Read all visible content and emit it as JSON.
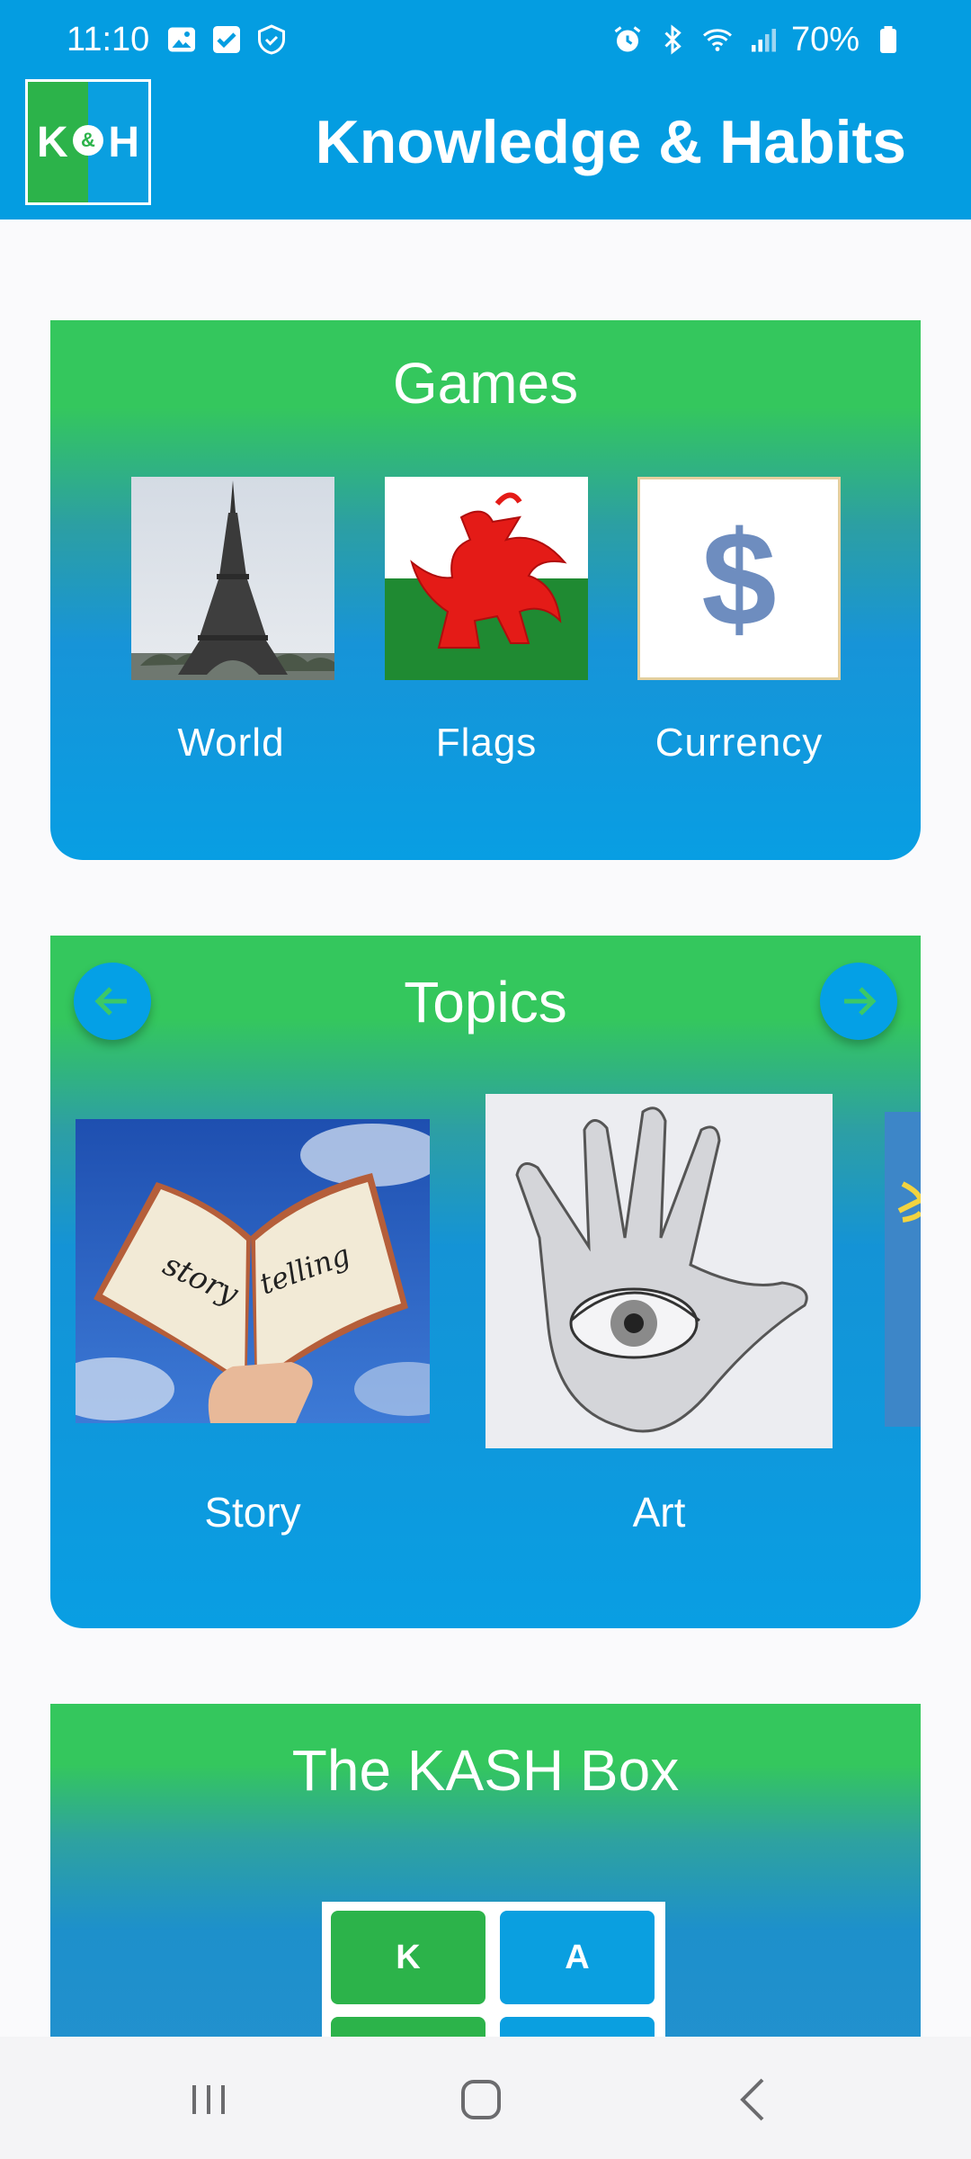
{
  "status_bar": {
    "time": "11:10",
    "battery": "70%",
    "left_icons": [
      "image-icon",
      "check-box-icon",
      "shield-icon"
    ],
    "right_icons": [
      "alarm-icon",
      "bluetooth-icon",
      "wifi-icon",
      "signal-icon",
      "battery-icon"
    ]
  },
  "header": {
    "logo_k": "K",
    "logo_amp": "&",
    "logo_h": "H",
    "title": "Knowledge & Habits"
  },
  "games": {
    "title": "Games",
    "items": [
      {
        "label": "World",
        "icon": "eiffel-tower-image"
      },
      {
        "label": "Flags",
        "icon": "welsh-flag-image"
      },
      {
        "label": "Currency",
        "icon": "dollar-sign-image",
        "symbol": "$"
      }
    ]
  },
  "topics": {
    "title": "Topics",
    "prev_icon": "arrow-left-icon",
    "next_icon": "arrow-right-icon",
    "items": [
      {
        "label": "Story",
        "icon": "storytelling-book-image",
        "book_left": "story",
        "book_right": "telling"
      },
      {
        "label": "Art",
        "icon": "hand-eye-drawing-image"
      }
    ]
  },
  "kash_box": {
    "title": "The KASH Box",
    "cells": [
      "K",
      "A"
    ]
  },
  "colors": {
    "primary_blue": "#049de1",
    "green": "#34c75d",
    "logo_green": "#2cb34a"
  }
}
